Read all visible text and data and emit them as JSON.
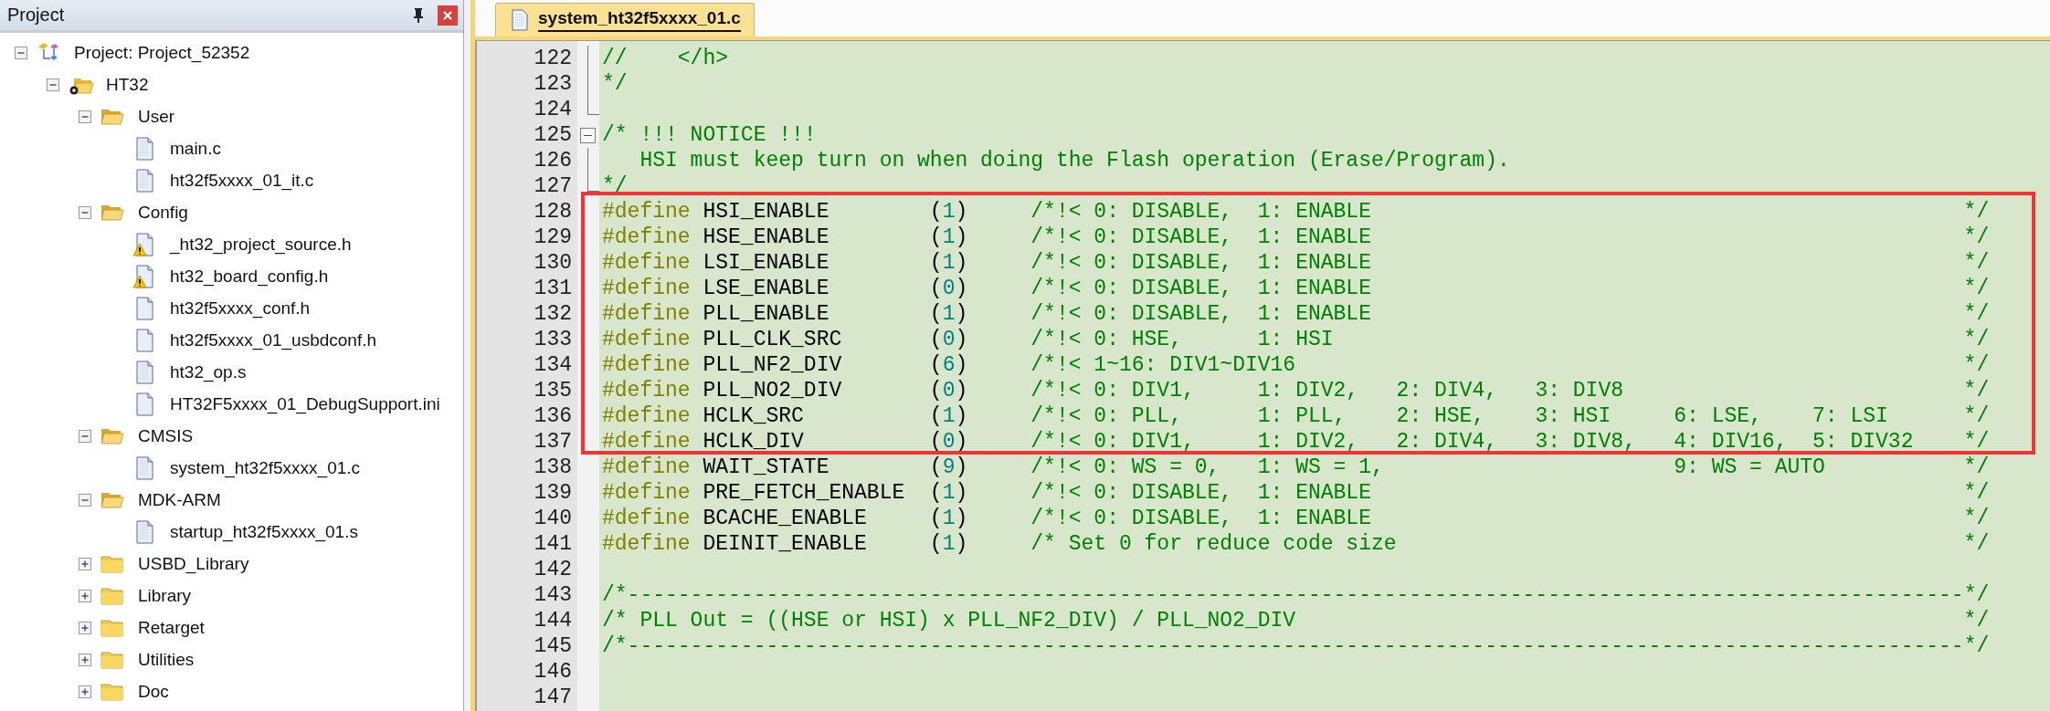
{
  "project_panel": {
    "title": "Project",
    "tree": [
      {
        "label": "Project: Project_52352",
        "kind": "project",
        "expanded": true,
        "children": [
          {
            "label": "HT32",
            "kind": "target",
            "expanded": true,
            "children": [
              {
                "label": "User",
                "kind": "group",
                "expanded": true,
                "children": [
                  {
                    "label": "main.c",
                    "kind": "source",
                    "warning": false
                  },
                  {
                    "label": "ht32f5xxxx_01_it.c",
                    "kind": "source",
                    "warning": false
                  }
                ]
              },
              {
                "label": "Config",
                "kind": "group",
                "expanded": true,
                "children": [
                  {
                    "label": "_ht32_project_source.h",
                    "kind": "text",
                    "warning": true
                  },
                  {
                    "label": "ht32_board_config.h",
                    "kind": "text",
                    "warning": true
                  },
                  {
                    "label": "ht32f5xxxx_conf.h",
                    "kind": "text",
                    "warning": false
                  },
                  {
                    "label": "ht32f5xxxx_01_usbdconf.h",
                    "kind": "text",
                    "warning": false
                  },
                  {
                    "label": "ht32_op.s",
                    "kind": "source",
                    "warning": false
                  },
                  {
                    "label": "HT32F5xxxx_01_DebugSupport.ini",
                    "kind": "text",
                    "warning": false
                  }
                ]
              },
              {
                "label": "CMSIS",
                "kind": "group",
                "expanded": true,
                "children": [
                  {
                    "label": "system_ht32f5xxxx_01.c",
                    "kind": "source",
                    "warning": false
                  }
                ]
              },
              {
                "label": "MDK-ARM",
                "kind": "group",
                "expanded": true,
                "children": [
                  {
                    "label": "startup_ht32f5xxxx_01.s",
                    "kind": "source",
                    "warning": false
                  }
                ]
              },
              {
                "label": "USBD_Library",
                "kind": "group",
                "expanded": false
              },
              {
                "label": "Library",
                "kind": "group",
                "expanded": false
              },
              {
                "label": "Retarget",
                "kind": "group",
                "expanded": false
              },
              {
                "label": "Utilities",
                "kind": "group",
                "expanded": false
              },
              {
                "label": "Doc",
                "kind": "group",
                "expanded": false
              }
            ]
          }
        ]
      }
    ]
  },
  "editor": {
    "tabs": [
      {
        "label": "system_ht32f5xxxx_01.c",
        "selected": true
      }
    ],
    "blocks": [
      {
        "highlighted": false,
        "lines": [
          {
            "number": "122",
            "kind": "fold_inner",
            "segments": [
              {
                "kind": "comment",
                "text": "//    </h>"
              }
            ]
          },
          {
            "number": "123",
            "kind": "fold_inner",
            "segments": [
              {
                "kind": "comment",
                "text": "*/"
              }
            ]
          },
          {
            "number": "124",
            "kind": "fold_end"
          },
          {
            "number": "125",
            "kind": "fold_start",
            "segments": [
              {
                "kind": "comment",
                "text": "/* !!! NOTICE !!!"
              }
            ]
          },
          {
            "number": "126",
            "kind": "fold_inner",
            "segments": [
              {
                "kind": "comment",
                "text": "   HSI must keep turn on when doing the Flash operation (Erase/Program)."
              }
            ]
          },
          {
            "number": "127",
            "kind": "fold_end",
            "segments": [
              {
                "kind": "comment",
                "text": "*/"
              }
            ]
          }
        ]
      },
      {
        "highlighted": true,
        "lines": [
          {
            "number": "128",
            "segments": [
              {
                "kind": "directive",
                "text": "#define"
              },
              {
                "kind": "plain",
                "text": " HSI_ENABLE        ("
              },
              {
                "kind": "number",
                "text": "1"
              },
              {
                "kind": "plain",
                "text": ")     "
              },
              {
                "kind": "comment",
                "text": "/*!< 0: DISABLE,  1: ENABLE"
              },
              {
                "kind": "comment_end",
                "text": " */"
              }
            ]
          },
          {
            "number": "129",
            "segments": [
              {
                "kind": "directive",
                "text": "#define"
              },
              {
                "kind": "plain",
                "text": " HSE_ENABLE        ("
              },
              {
                "kind": "number",
                "text": "1"
              },
              {
                "kind": "plain",
                "text": ")     "
              },
              {
                "kind": "comment",
                "text": "/*!< 0: DISABLE,  1: ENABLE"
              },
              {
                "kind": "comment_end",
                "text": " */"
              }
            ]
          },
          {
            "number": "130",
            "segments": [
              {
                "kind": "directive",
                "text": "#define"
              },
              {
                "kind": "plain",
                "text": " LSI_ENABLE        ("
              },
              {
                "kind": "number",
                "text": "1"
              },
              {
                "kind": "plain",
                "text": ")     "
              },
              {
                "kind": "comment",
                "text": "/*!< 0: DISABLE,  1: ENABLE"
              },
              {
                "kind": "comment_end",
                "text": " */"
              }
            ]
          },
          {
            "number": "131",
            "segments": [
              {
                "kind": "directive",
                "text": "#define"
              },
              {
                "kind": "plain",
                "text": " LSE_ENABLE        ("
              },
              {
                "kind": "number",
                "text": "0"
              },
              {
                "kind": "plain",
                "text": ")     "
              },
              {
                "kind": "comment",
                "text": "/*!< 0: DISABLE,  1: ENABLE"
              },
              {
                "kind": "comment_end",
                "text": " */"
              }
            ]
          },
          {
            "number": "132",
            "segments": [
              {
                "kind": "directive",
                "text": "#define"
              },
              {
                "kind": "plain",
                "text": " PLL_ENABLE        ("
              },
              {
                "kind": "number",
                "text": "1"
              },
              {
                "kind": "plain",
                "text": ")     "
              },
              {
                "kind": "comment",
                "text": "/*!< 0: DISABLE,  1: ENABLE"
              },
              {
                "kind": "comment_end",
                "text": " */"
              }
            ]
          },
          {
            "number": "133",
            "segments": [
              {
                "kind": "directive",
                "text": "#define"
              },
              {
                "kind": "plain",
                "text": " PLL_CLK_SRC       ("
              },
              {
                "kind": "number",
                "text": "0"
              },
              {
                "kind": "plain",
                "text": ")     "
              },
              {
                "kind": "comment",
                "text": "/*!< 0: HSE,      1: HSI"
              },
              {
                "kind": "comment_end",
                "text": " */"
              }
            ]
          },
          {
            "number": "134",
            "segments": [
              {
                "kind": "directive",
                "text": "#define"
              },
              {
                "kind": "plain",
                "text": " PLL_NF2_DIV       ("
              },
              {
                "kind": "number",
                "text": "6"
              },
              {
                "kind": "plain",
                "text": ")     "
              },
              {
                "kind": "comment",
                "text": "/*!< 1~16: DIV1~DIV16"
              },
              {
                "kind": "comment_end",
                "text": " */"
              }
            ]
          },
          {
            "number": "135",
            "segments": [
              {
                "kind": "directive",
                "text": "#define"
              },
              {
                "kind": "plain",
                "text": " PLL_NO2_DIV       ("
              },
              {
                "kind": "number",
                "text": "0"
              },
              {
                "kind": "plain",
                "text": ")     "
              },
              {
                "kind": "comment",
                "text": "/*!< 0: DIV1,     1: DIV2,   2: DIV4,   3: DIV8"
              },
              {
                "kind": "comment_end",
                "text": " */"
              }
            ]
          },
          {
            "number": "136",
            "segments": [
              {
                "kind": "directive",
                "text": "#define"
              },
              {
                "kind": "plain",
                "text": " HCLK_SRC          ("
              },
              {
                "kind": "number",
                "text": "1"
              },
              {
                "kind": "plain",
                "text": ")     "
              },
              {
                "kind": "comment",
                "text": "/*!< 0: PLL,      1: PLL,    2: HSE,    3: HSI     6: LSE,    7: LSI"
              },
              {
                "kind": "comment_end",
                "text": " */"
              }
            ]
          },
          {
            "number": "137",
            "segments": [
              {
                "kind": "directive",
                "text": "#define"
              },
              {
                "kind": "plain",
                "text": " HCLK_DIV          ("
              },
              {
                "kind": "number",
                "text": "0"
              },
              {
                "kind": "plain",
                "text": ")     "
              },
              {
                "kind": "comment",
                "text": "/*!< 0: DIV1,     1: DIV2,   2: DIV4,   3: DIV8,   4: DIV16,  5: DIV32"
              },
              {
                "kind": "comment_end",
                "text": " */"
              }
            ]
          }
        ]
      },
      {
        "highlighted": false,
        "lines": [
          {
            "number": "138",
            "segments": [
              {
                "kind": "directive",
                "text": "#define"
              },
              {
                "kind": "plain",
                "text": " WAIT_STATE        ("
              },
              {
                "kind": "number",
                "text": "9"
              },
              {
                "kind": "plain",
                "text": ")     "
              },
              {
                "kind": "comment",
                "text": "/*!< 0: WS = 0,   1: WS = 1,                       9: WS = AUTO"
              },
              {
                "kind": "comment_end",
                "text": " */"
              }
            ]
          },
          {
            "number": "139",
            "segments": [
              {
                "kind": "directive",
                "text": "#define"
              },
              {
                "kind": "plain",
                "text": " PRE_FETCH_ENABLE  ("
              },
              {
                "kind": "number",
                "text": "1"
              },
              {
                "kind": "plain",
                "text": ")     "
              },
              {
                "kind": "comment",
                "text": "/*!< 0: DISABLE,  1: ENABLE"
              },
              {
                "kind": "comment_end",
                "text": " */"
              }
            ]
          },
          {
            "number": "140",
            "segments": [
              {
                "kind": "directive",
                "text": "#define"
              },
              {
                "kind": "plain",
                "text": " BCACHE_ENABLE     ("
              },
              {
                "kind": "number",
                "text": "1"
              },
              {
                "kind": "plain",
                "text": ")     "
              },
              {
                "kind": "comment",
                "text": "/*!< 0: DISABLE,  1: ENABLE"
              },
              {
                "kind": "comment_end",
                "text": " */"
              }
            ]
          },
          {
            "number": "141",
            "segments": [
              {
                "kind": "directive",
                "text": "#define"
              },
              {
                "kind": "plain",
                "text": " DEINIT_ENABLE     ("
              },
              {
                "kind": "number",
                "text": "1"
              },
              {
                "kind": "plain",
                "text": ")     "
              },
              {
                "kind": "comment",
                "text": "/* Set 0 for reduce code size"
              },
              {
                "kind": "comment_end",
                "text": " */"
              }
            ]
          },
          {
            "number": "142"
          },
          {
            "number": "143",
            "segments": [
              {
                "kind": "comment",
                "text": "/*----------------------------------------------------------------------------------------------------------"
              },
              {
                "kind": "comment_end",
                "text": "*/"
              }
            ]
          },
          {
            "number": "144",
            "segments": [
              {
                "kind": "comment",
                "text": "/* PLL Out = ((HSE or HSI) x PLL_NF2_DIV) / PLL_NO2_DIV"
              },
              {
                "kind": "comment_end",
                "text": " */"
              }
            ]
          },
          {
            "number": "145",
            "segments": [
              {
                "kind": "comment",
                "text": "/*----------------------------------------------------------------------------------------------------------"
              },
              {
                "kind": "comment_end",
                "text": "*/"
              }
            ]
          },
          {
            "number": "146"
          },
          {
            "number": "147"
          }
        ]
      }
    ]
  }
}
